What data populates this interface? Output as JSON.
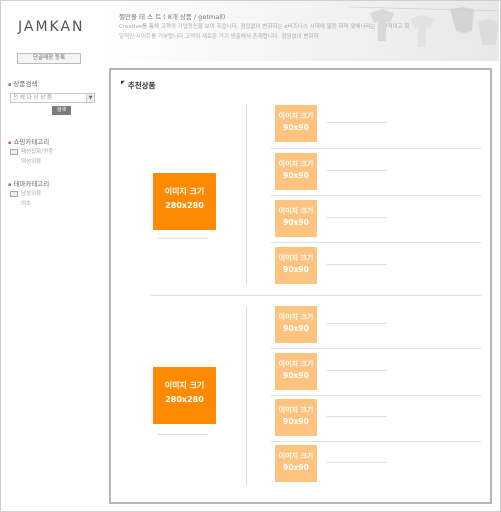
{
  "header": {
    "logo": "JAMKAN",
    "register_button": "단골매장 등록",
    "banner_title": "쩔만몰 테 스 트 ( 8개 상품 / getmall)",
    "banner_line1": "Creative를 통해 고객의 가업정신을 보여 주습니다. 점입없이 변화하는 e비즈니스 시대에 필등 하며 앞에나라는 발전적이고 획",
    "banner_line2": "일적인 사이트를 거부합니다.고객의 새로운 가기 방출에서 존재합니다. 점임없이 변화하"
  },
  "sidebar": {
    "search_title": "상품검색",
    "search_select_value": "전 체 다 상 상 품",
    "search_button": "검색",
    "shop_category_title": "쇼핑카테고리",
    "shop_category_items": [
      "패션잡화/명품",
      "여성의류"
    ],
    "theme_category_title": "테마카테고리",
    "theme_category_items": [
      "남성의류",
      "의초"
    ]
  },
  "main": {
    "title": "추천상품",
    "big_items": [
      {
        "line1": "이미지 크기",
        "line2": "280x280"
      },
      {
        "line1": "이미지 크기",
        "line2": "280x280"
      }
    ],
    "small_items": [
      {
        "line1": "이미지 크기",
        "line2": "90x90"
      },
      {
        "line1": "이미지 크기",
        "line2": "90x90"
      },
      {
        "line1": "이미지 크기",
        "line2": "90x90"
      },
      {
        "line1": "이미지 크기",
        "line2": "90x90"
      },
      {
        "line1": "이미지 크기",
        "line2": "90x90"
      },
      {
        "line1": "이미지 크기",
        "line2": "90x90"
      },
      {
        "line1": "이미지 크기",
        "line2": "90x90"
      },
      {
        "line1": "이미지 크기",
        "line2": "90x90"
      }
    ]
  },
  "colors": {
    "big_image": "#fe8a04",
    "small_image": "#fdc37f"
  }
}
